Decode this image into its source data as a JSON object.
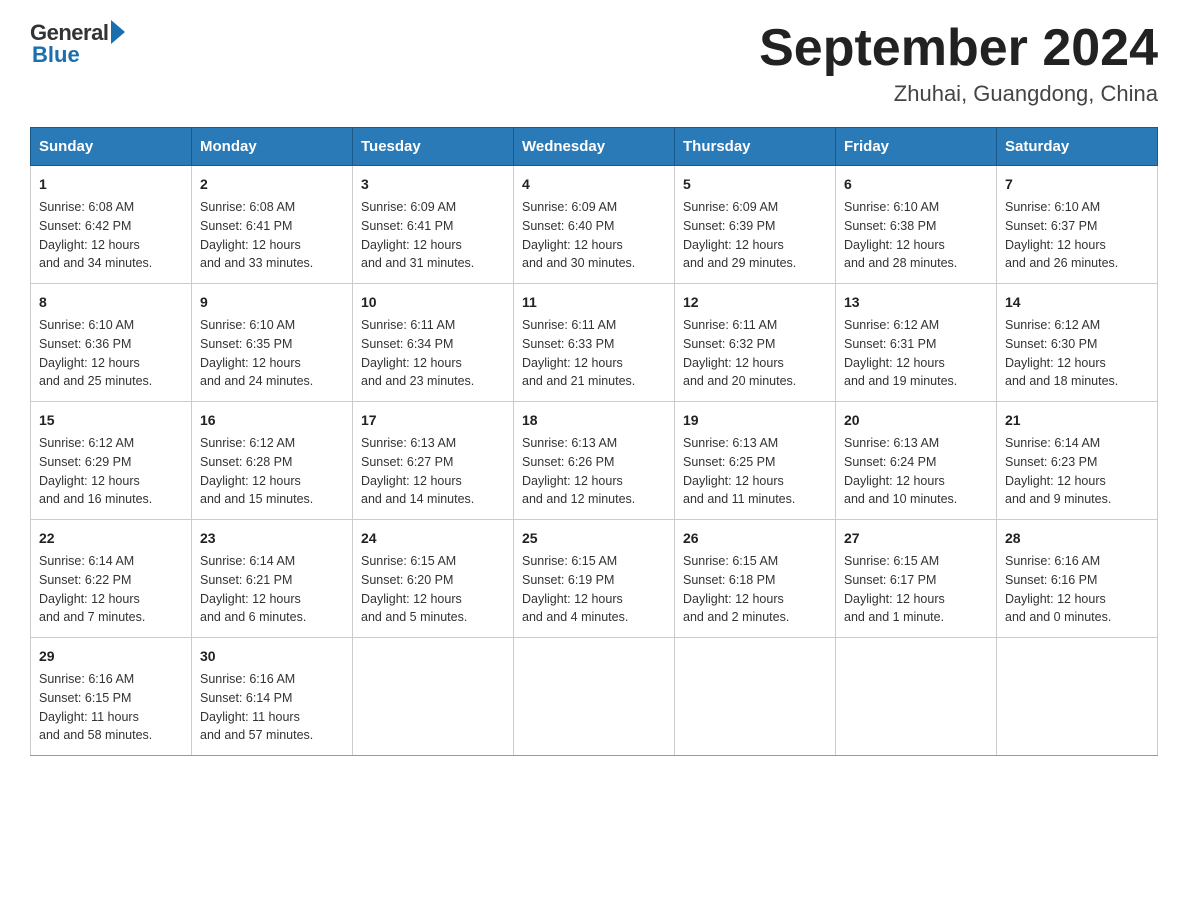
{
  "header": {
    "logo": {
      "general": "General",
      "blue": "Blue"
    },
    "title": "September 2024",
    "location": "Zhuhai, Guangdong, China"
  },
  "columns": [
    "Sunday",
    "Monday",
    "Tuesday",
    "Wednesday",
    "Thursday",
    "Friday",
    "Saturday"
  ],
  "weeks": [
    [
      {
        "day": "1",
        "sunrise": "6:08 AM",
        "sunset": "6:42 PM",
        "daylight": "12 hours and 34 minutes."
      },
      {
        "day": "2",
        "sunrise": "6:08 AM",
        "sunset": "6:41 PM",
        "daylight": "12 hours and 33 minutes."
      },
      {
        "day": "3",
        "sunrise": "6:09 AM",
        "sunset": "6:41 PM",
        "daylight": "12 hours and 31 minutes."
      },
      {
        "day": "4",
        "sunrise": "6:09 AM",
        "sunset": "6:40 PM",
        "daylight": "12 hours and 30 minutes."
      },
      {
        "day": "5",
        "sunrise": "6:09 AM",
        "sunset": "6:39 PM",
        "daylight": "12 hours and 29 minutes."
      },
      {
        "day": "6",
        "sunrise": "6:10 AM",
        "sunset": "6:38 PM",
        "daylight": "12 hours and 28 minutes."
      },
      {
        "day": "7",
        "sunrise": "6:10 AM",
        "sunset": "6:37 PM",
        "daylight": "12 hours and 26 minutes."
      }
    ],
    [
      {
        "day": "8",
        "sunrise": "6:10 AM",
        "sunset": "6:36 PM",
        "daylight": "12 hours and 25 minutes."
      },
      {
        "day": "9",
        "sunrise": "6:10 AM",
        "sunset": "6:35 PM",
        "daylight": "12 hours and 24 minutes."
      },
      {
        "day": "10",
        "sunrise": "6:11 AM",
        "sunset": "6:34 PM",
        "daylight": "12 hours and 23 minutes."
      },
      {
        "day": "11",
        "sunrise": "6:11 AM",
        "sunset": "6:33 PM",
        "daylight": "12 hours and 21 minutes."
      },
      {
        "day": "12",
        "sunrise": "6:11 AM",
        "sunset": "6:32 PM",
        "daylight": "12 hours and 20 minutes."
      },
      {
        "day": "13",
        "sunrise": "6:12 AM",
        "sunset": "6:31 PM",
        "daylight": "12 hours and 19 minutes."
      },
      {
        "day": "14",
        "sunrise": "6:12 AM",
        "sunset": "6:30 PM",
        "daylight": "12 hours and 18 minutes."
      }
    ],
    [
      {
        "day": "15",
        "sunrise": "6:12 AM",
        "sunset": "6:29 PM",
        "daylight": "12 hours and 16 minutes."
      },
      {
        "day": "16",
        "sunrise": "6:12 AM",
        "sunset": "6:28 PM",
        "daylight": "12 hours and 15 minutes."
      },
      {
        "day": "17",
        "sunrise": "6:13 AM",
        "sunset": "6:27 PM",
        "daylight": "12 hours and 14 minutes."
      },
      {
        "day": "18",
        "sunrise": "6:13 AM",
        "sunset": "6:26 PM",
        "daylight": "12 hours and 12 minutes."
      },
      {
        "day": "19",
        "sunrise": "6:13 AM",
        "sunset": "6:25 PM",
        "daylight": "12 hours and 11 minutes."
      },
      {
        "day": "20",
        "sunrise": "6:13 AM",
        "sunset": "6:24 PM",
        "daylight": "12 hours and 10 minutes."
      },
      {
        "day": "21",
        "sunrise": "6:14 AM",
        "sunset": "6:23 PM",
        "daylight": "12 hours and 9 minutes."
      }
    ],
    [
      {
        "day": "22",
        "sunrise": "6:14 AM",
        "sunset": "6:22 PM",
        "daylight": "12 hours and 7 minutes."
      },
      {
        "day": "23",
        "sunrise": "6:14 AM",
        "sunset": "6:21 PM",
        "daylight": "12 hours and 6 minutes."
      },
      {
        "day": "24",
        "sunrise": "6:15 AM",
        "sunset": "6:20 PM",
        "daylight": "12 hours and 5 minutes."
      },
      {
        "day": "25",
        "sunrise": "6:15 AM",
        "sunset": "6:19 PM",
        "daylight": "12 hours and 4 minutes."
      },
      {
        "day": "26",
        "sunrise": "6:15 AM",
        "sunset": "6:18 PM",
        "daylight": "12 hours and 2 minutes."
      },
      {
        "day": "27",
        "sunrise": "6:15 AM",
        "sunset": "6:17 PM",
        "daylight": "12 hours and 1 minute."
      },
      {
        "day": "28",
        "sunrise": "6:16 AM",
        "sunset": "6:16 PM",
        "daylight": "12 hours and 0 minutes."
      }
    ],
    [
      {
        "day": "29",
        "sunrise": "6:16 AM",
        "sunset": "6:15 PM",
        "daylight": "11 hours and 58 minutes."
      },
      {
        "day": "30",
        "sunrise": "6:16 AM",
        "sunset": "6:14 PM",
        "daylight": "11 hours and 57 minutes."
      },
      null,
      null,
      null,
      null,
      null
    ]
  ],
  "labels": {
    "sunrise": "Sunrise:",
    "sunset": "Sunset:",
    "daylight": "Daylight:"
  }
}
